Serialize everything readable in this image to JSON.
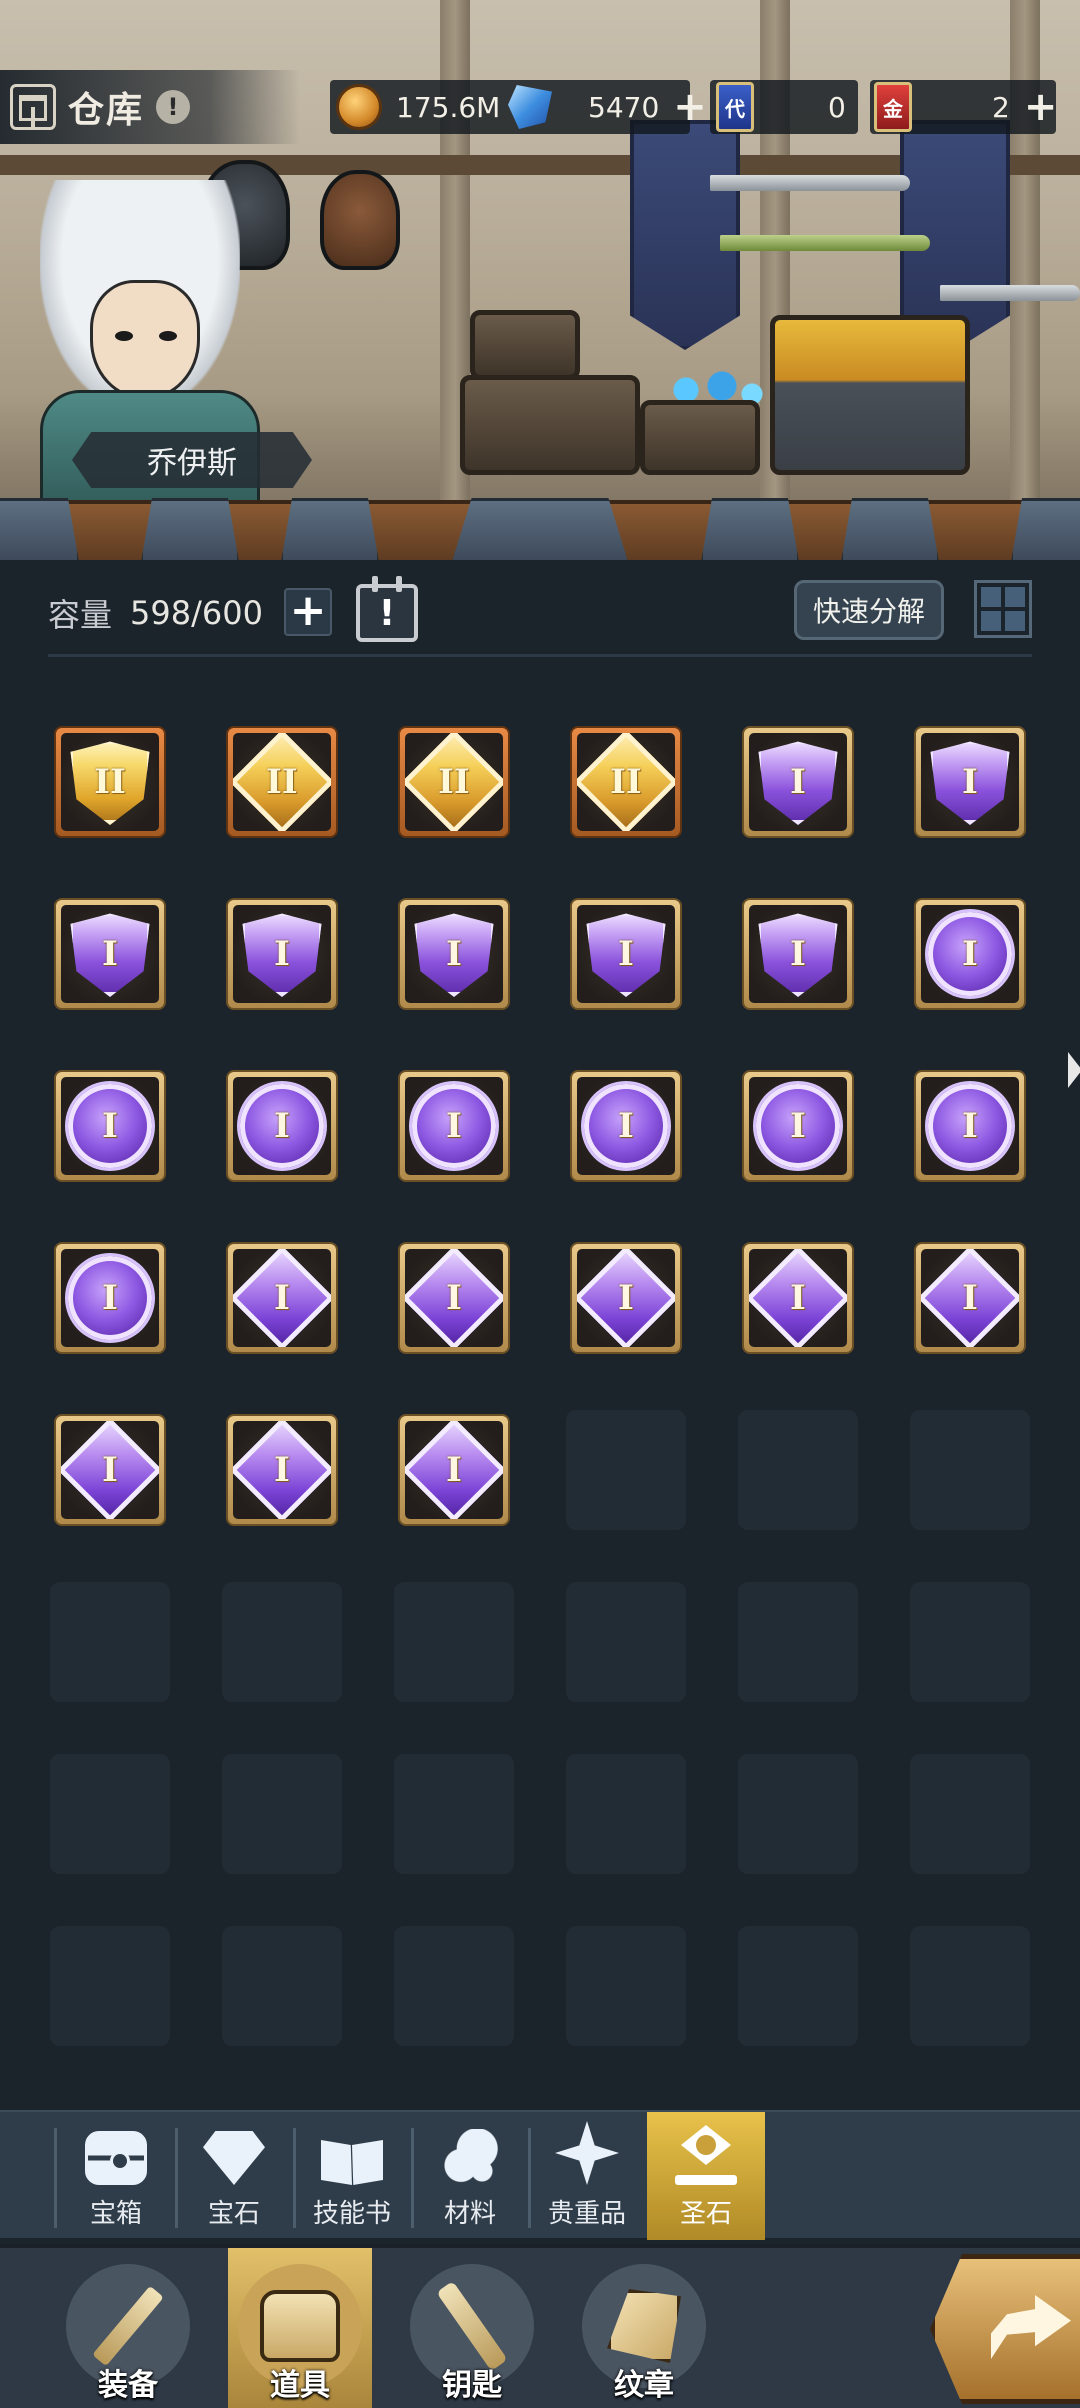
{
  "header": {
    "title": "仓库",
    "title_icon": "home-icon",
    "info_icon": "info-icon",
    "resources": {
      "gold": {
        "icon": "gold-coin-icon",
        "value": "175.6M"
      },
      "crystal": {
        "icon": "blue-crystal-icon",
        "value": "5470"
      },
      "blue_card": {
        "icon": "blue-card-icon",
        "glyph": "代",
        "value": "0"
      },
      "red_card": {
        "icon": "red-card-icon",
        "glyph": "金",
        "value": "2"
      }
    },
    "plus_symbol": "+"
  },
  "hero": {
    "name": "乔伊斯"
  },
  "capacity": {
    "label": "容量",
    "value": "598/600",
    "add_symbol": "+",
    "calendar_symbol": "!",
    "quick_decompose_label": "快速分解"
  },
  "inventory": {
    "total_slots": 48,
    "items": [
      {
        "shape": "shield",
        "color": "gold",
        "frame": "orange",
        "numeral": "II"
      },
      {
        "shape": "diamond",
        "color": "gold",
        "frame": "orange",
        "numeral": "II"
      },
      {
        "shape": "diamond",
        "color": "gold",
        "frame": "orange",
        "numeral": "II"
      },
      {
        "shape": "diamond",
        "color": "gold",
        "frame": "orange",
        "numeral": "II"
      },
      {
        "shape": "shield",
        "color": "purple",
        "frame": "gold",
        "numeral": "I"
      },
      {
        "shape": "shield",
        "color": "purple",
        "frame": "gold",
        "numeral": "I"
      },
      {
        "shape": "shield",
        "color": "purple",
        "frame": "gold",
        "numeral": "I"
      },
      {
        "shape": "shield",
        "color": "purple",
        "frame": "gold",
        "numeral": "I"
      },
      {
        "shape": "shield",
        "color": "purple",
        "frame": "gold",
        "numeral": "I"
      },
      {
        "shape": "shield",
        "color": "purple",
        "frame": "gold",
        "numeral": "I"
      },
      {
        "shape": "shield",
        "color": "purple",
        "frame": "gold",
        "numeral": "I"
      },
      {
        "shape": "circle",
        "color": "purple",
        "frame": "gold",
        "numeral": "I"
      },
      {
        "shape": "circle",
        "color": "purple",
        "frame": "gold",
        "numeral": "I"
      },
      {
        "shape": "circle",
        "color": "purple",
        "frame": "gold",
        "numeral": "I"
      },
      {
        "shape": "circle",
        "color": "purple",
        "frame": "gold",
        "numeral": "I"
      },
      {
        "shape": "circle",
        "color": "purple",
        "frame": "gold",
        "numeral": "I"
      },
      {
        "shape": "circle",
        "color": "purple",
        "frame": "gold",
        "numeral": "I"
      },
      {
        "shape": "circle",
        "color": "purple",
        "frame": "gold",
        "numeral": "I"
      },
      {
        "shape": "circle",
        "color": "purple",
        "frame": "gold",
        "numeral": "I"
      },
      {
        "shape": "diamond",
        "color": "purple",
        "frame": "gold",
        "numeral": "I"
      },
      {
        "shape": "diamond",
        "color": "purple",
        "frame": "gold",
        "numeral": "I"
      },
      {
        "shape": "diamond",
        "color": "purple",
        "frame": "gold",
        "numeral": "I"
      },
      {
        "shape": "diamond",
        "color": "purple",
        "frame": "gold",
        "numeral": "I"
      },
      {
        "shape": "diamond",
        "color": "purple",
        "frame": "gold",
        "numeral": "I"
      },
      {
        "shape": "diamond",
        "color": "purple",
        "frame": "gold",
        "numeral": "I"
      },
      {
        "shape": "diamond",
        "color": "purple",
        "frame": "gold",
        "numeral": "I"
      },
      {
        "shape": "diamond",
        "color": "purple",
        "frame": "gold",
        "numeral": "I"
      }
    ]
  },
  "category_tabs": [
    {
      "id": "chest",
      "label": "宝箱",
      "icon": "chest-icon",
      "active": false
    },
    {
      "id": "gem",
      "label": "宝石",
      "icon": "gem-icon",
      "active": false
    },
    {
      "id": "skillbook",
      "label": "技能书",
      "icon": "book-icon",
      "active": false
    },
    {
      "id": "material",
      "label": "材料",
      "icon": "ore-icon",
      "active": false
    },
    {
      "id": "valuable",
      "label": "贵重品",
      "icon": "star-icon",
      "active": false
    },
    {
      "id": "holystone",
      "label": "圣石",
      "icon": "holy-stone-icon",
      "active": true
    }
  ],
  "bottom_nav": [
    {
      "id": "equipment",
      "label": "装备",
      "icon": "sword-icon",
      "active": false
    },
    {
      "id": "items",
      "label": "道具",
      "icon": "bag-icon",
      "active": true
    },
    {
      "id": "keys",
      "label": "钥匙",
      "icon": "key-icon",
      "active": false
    },
    {
      "id": "emblems",
      "label": "纹章",
      "icon": "emblem-icon",
      "active": false
    }
  ],
  "share_icon": "share-arrow-icon",
  "colors": {
    "background": "#1b232b",
    "active_tab": "#e8c24a",
    "purple_gem": "#8a52dc",
    "gold_gem": "#e0a52a"
  }
}
